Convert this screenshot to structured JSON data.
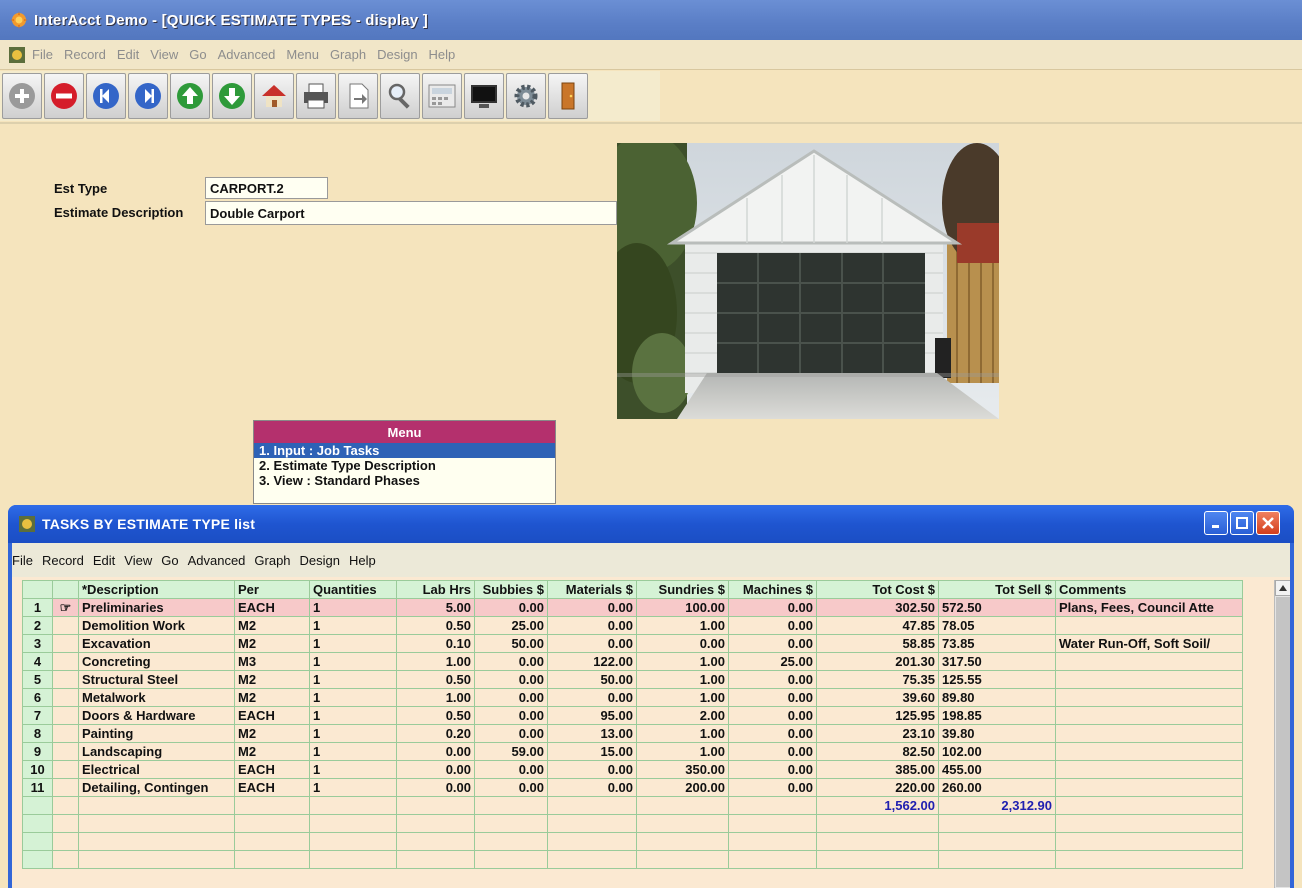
{
  "app": {
    "title": "InterAcct Demo - [QUICK ESTIMATE TYPES - display ]"
  },
  "main_menu": [
    "File",
    "Record",
    "Edit",
    "View",
    "Go",
    "Advanced",
    "Menu",
    "Graph",
    "Design",
    "Help"
  ],
  "toolbar": [
    {
      "name": "add-icon"
    },
    {
      "name": "delete-icon"
    },
    {
      "name": "first-record-icon"
    },
    {
      "name": "last-record-icon"
    },
    {
      "name": "previous-icon"
    },
    {
      "name": "next-icon"
    },
    {
      "name": "home-icon"
    },
    {
      "name": "print-icon"
    },
    {
      "name": "export-icon"
    },
    {
      "name": "search-icon"
    },
    {
      "name": "calculator-icon"
    },
    {
      "name": "monitor-icon"
    },
    {
      "name": "settings-icon"
    },
    {
      "name": "exit-door-icon"
    }
  ],
  "form": {
    "est_type_label": "Est Type",
    "est_type_value": "CARPORT.2",
    "desc_label": "Estimate Description",
    "desc_value": "Double Carport"
  },
  "menu_panel": {
    "title": "Menu",
    "items": [
      "1. Input : Job Tasks",
      "2. Estimate Type Description",
      "3. View : Standard Phases"
    ],
    "selected": 0
  },
  "child_window": {
    "title": "TASKS BY ESTIMATE TYPE list",
    "menu": [
      "File",
      "Record",
      "Edit",
      "View",
      "Go",
      "Advanced",
      "Graph",
      "Design",
      "Help"
    ]
  },
  "table": {
    "columns": [
      "",
      "",
      "*Description",
      "Per",
      "Quantities",
      "Lab Hrs",
      "Subbies $",
      "Materials $",
      "Sundries $",
      "Machines $",
      "Tot Cost $",
      "Tot Sell $",
      "Comments"
    ],
    "rows": [
      [
        "1",
        "Preliminaries",
        "EACH",
        "1",
        "5.00",
        "0.00",
        "0.00",
        "100.00",
        "0.00",
        "302.50",
        "572.50",
        "Plans, Fees, Council Atte"
      ],
      [
        "2",
        "Demolition Work",
        "M2",
        "1",
        "0.50",
        "25.00",
        "0.00",
        "1.00",
        "0.00",
        "47.85",
        "78.05",
        ""
      ],
      [
        "3",
        "Excavation",
        "M2",
        "1",
        "0.10",
        "50.00",
        "0.00",
        "0.00",
        "0.00",
        "58.85",
        "73.85",
        "Water Run-Off, Soft Soil/"
      ],
      [
        "4",
        "Concreting",
        "M3",
        "1",
        "1.00",
        "0.00",
        "122.00",
        "1.00",
        "25.00",
        "201.30",
        "317.50",
        ""
      ],
      [
        "5",
        "Structural Steel",
        "M2",
        "1",
        "0.50",
        "0.00",
        "50.00",
        "1.00",
        "0.00",
        "75.35",
        "125.55",
        ""
      ],
      [
        "6",
        "Metalwork",
        "M2",
        "1",
        "1.00",
        "0.00",
        "0.00",
        "1.00",
        "0.00",
        "39.60",
        "89.80",
        ""
      ],
      [
        "7",
        "Doors & Hardware",
        "EACH",
        "1",
        "0.50",
        "0.00",
        "95.00",
        "2.00",
        "0.00",
        "125.95",
        "198.85",
        ""
      ],
      [
        "8",
        "Painting",
        "M2",
        "1",
        "0.20",
        "0.00",
        "13.00",
        "1.00",
        "0.00",
        "23.10",
        "39.80",
        ""
      ],
      [
        "9",
        "Landscaping",
        "M2",
        "1",
        "0.00",
        "59.00",
        "15.00",
        "1.00",
        "0.00",
        "82.50",
        "102.00",
        ""
      ],
      [
        "10",
        "Electrical",
        "EACH",
        "1",
        "0.00",
        "0.00",
        "0.00",
        "350.00",
        "0.00",
        "385.00",
        "455.00",
        ""
      ],
      [
        "11",
        "Detailing, Contingen",
        "EACH",
        "1",
        "0.00",
        "0.00",
        "0.00",
        "200.00",
        "0.00",
        "220.00",
        "260.00",
        ""
      ]
    ],
    "totals": {
      "tot_cost": "1,562.00",
      "tot_sell": "2,312.90"
    },
    "selected_row": 0,
    "pointer_glyph": "☞"
  }
}
